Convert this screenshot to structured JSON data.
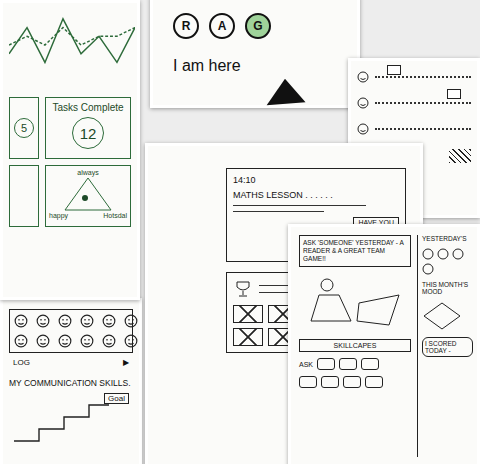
{
  "mood_chart": {
    "series": [
      {
        "kind": "solid",
        "color": "#2d6b3a",
        "values": [
          2,
          5,
          1,
          6,
          2,
          4,
          1,
          5
        ]
      },
      {
        "kind": "dotted",
        "color": "#2d6b3a",
        "values": [
          3,
          4,
          3,
          5,
          3,
          4,
          4,
          5
        ]
      }
    ],
    "max": 6
  },
  "tasks_panel": {
    "small_value": "5",
    "title": "Tasks Complete",
    "value": "12"
  },
  "mood_triangle": {
    "top_label": "always",
    "bottom_left": "happy",
    "bottom_right": "Hotsdal"
  },
  "rag": {
    "options": [
      {
        "label": "R",
        "selected": false
      },
      {
        "label": "A",
        "selected": false
      },
      {
        "label": "G",
        "selected": true
      }
    ],
    "caption": "I am here"
  },
  "timetable": {
    "time": "14:10",
    "lesson": "MATHS LESSON . . . . . .",
    "prompt": "HAVE YOU"
  },
  "diary": {
    "entry": "ASK 'SOMEONE' YESTERDAY - A READER & A GREAT TEAM GAME!!",
    "yesterday": "YESTERDAY'S",
    "month": "THIS MONTH'S MOOD",
    "skills": "SKILLCAPES",
    "score": "I SCORED TODAY -",
    "ask": "ASK"
  },
  "log": {
    "label": "LOG",
    "play": "▶"
  },
  "skills": {
    "title": "MY COMMUNICATION SKILLS.",
    "goal": "Goal"
  }
}
